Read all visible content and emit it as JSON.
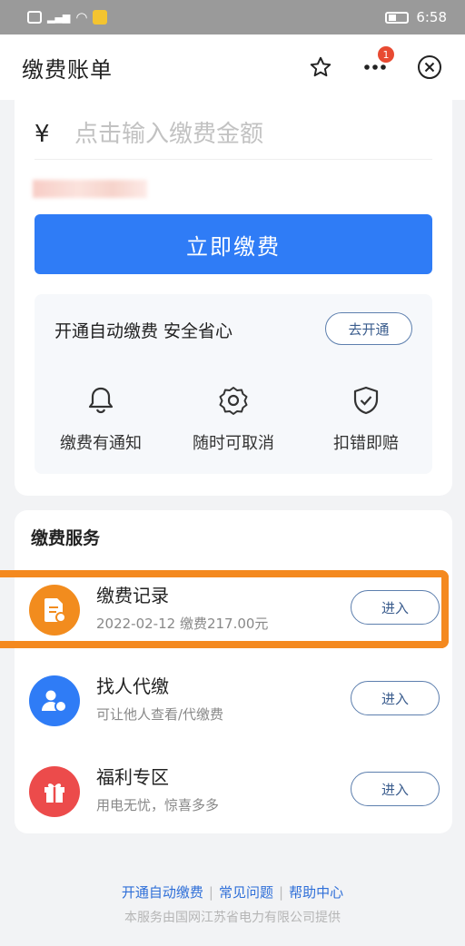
{
  "status_bar": {
    "time": "6:58"
  },
  "header": {
    "title": "缴费账单",
    "badge_count": "1"
  },
  "payment": {
    "currency_symbol": "¥",
    "amount_placeholder": "点击输入缴费金额",
    "pay_button": "立即缴费"
  },
  "autopay": {
    "title": "开通自动缴费 安全省心",
    "open_button": "去开通",
    "features": [
      {
        "label": "缴费有通知",
        "icon": "bell-icon"
      },
      {
        "label": "随时可取消",
        "icon": "settings-icon"
      },
      {
        "label": "扣错即赔",
        "icon": "shield-icon"
      }
    ]
  },
  "services": {
    "title": "缴费服务",
    "items": [
      {
        "name": "缴费记录",
        "desc": "2022-02-12 缴费217.00元",
        "button": "进入",
        "icon": "bill-record-icon",
        "color": "#f28c1e"
      },
      {
        "name": "找人代缴",
        "desc": "可让他人查看/代缴费",
        "button": "进入",
        "icon": "user-pay-icon",
        "color": "#2f7cf6"
      },
      {
        "name": "福利专区",
        "desc": "用电无忧，惊喜多多",
        "button": "进入",
        "icon": "gift-icon",
        "color": "#ec4b4b"
      }
    ]
  },
  "footer": {
    "links": [
      "开通自动缴费",
      "常见问题",
      "帮助中心"
    ],
    "note": "本服务由国网江苏省电力有限公司提供"
  },
  "colors": {
    "primary": "#2f7cf6",
    "highlight": "#f4891f"
  }
}
